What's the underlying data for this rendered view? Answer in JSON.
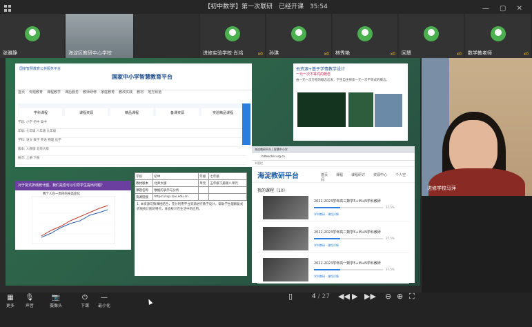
{
  "titlebar": {
    "title": "【初中数学】第一次联研",
    "status": "已经开课",
    "time": "35:54"
  },
  "participants": [
    {
      "name": "张雅静",
      "badge": "",
      "kind": "avatar"
    },
    {
      "name": "海淀区教研中心学校",
      "badge": "",
      "kind": "room"
    },
    {
      "name": "",
      "badge": "",
      "kind": "blank"
    },
    {
      "name": "进修实验学校·肖鸿",
      "badge": "x0",
      "kind": "avatar"
    },
    {
      "name": "孙琪",
      "badge": "x0",
      "kind": "avatar"
    },
    {
      "name": "林秀艳",
      "badge": "x0",
      "kind": "avatar"
    },
    {
      "name": "回慧",
      "badge": "x0",
      "kind": "avatar"
    },
    {
      "name": "数学教老师",
      "badge": "x0",
      "kind": "avatar"
    }
  ],
  "speaker": {
    "label": "进修学校马萍"
  },
  "platform": {
    "header_logo": "国家智慧教育公共服务平台",
    "title": "国家中小学智慧教育平台",
    "nav": [
      "首页",
      "专题教育",
      "课程教学",
      "课后服务",
      "教师研修",
      "家庭教育",
      "教改实践",
      "教材",
      "地方频道"
    ],
    "cards": [
      "学科课程",
      "课程资源",
      "精品课程",
      "备课资源",
      "实验精品课程"
    ],
    "filters": [
      "学段: 小学 初中 高中",
      "年级: 七年级 八年级 九年级",
      "学科: 语文 数学 英语 物理 化学",
      "版本: 人教版 北师大版",
      "册次: 上册 下册"
    ]
  },
  "doc": {
    "rows": [
      [
        "学段",
        "初中",
        "年级",
        "七年级"
      ],
      [
        "教材版本",
        "北师大版",
        "单元",
        "五年级下册第八单元"
      ],
      [
        "课题名称",
        "数据的表示与分析",
        "",
        ""
      ],
      [
        "资源链接",
        "https://ssp.zxx.edu.cn",
        "",
        ""
      ]
    ],
    "paragraph": "1. 本资源与微课相结合，充分利用平台资源进行教学设计，帮助学生理解复式折线统计图的特点，体会统计在生活中的应用。"
  },
  "graph": {
    "header": "对于复式折线统计图，我们是否可以引导学生提出问题？",
    "chart_title": "两个人在一周内的身高变化"
  },
  "design": {
    "title": "云资源+基于学情教学设计",
    "subtitle": "一元一次不等式的概念",
    "text": "由一元一次方程的概念出发，学生自主探索一元一次不等式的概念。"
  },
  "browser": {
    "tabs": "海淀教研平台 | 智慧中小学",
    "url": "hdteacher.org.cn",
    "bookmarks": "书签栏",
    "brand": "海淀教研平台",
    "menu": [
      "首页",
      "课程",
      "课程研讨",
      "资源中心",
      "个人空间"
    ],
    "my_courses": "我的课程（10）",
    "courses": [
      {
        "title": "2022-2023学年高三数学5+M+N学科教研",
        "pct": "37.5%",
        "pct_value": 0.375,
        "sub": "学科教研 · 课程详情"
      },
      {
        "title": "2022-2023学年高二数学5+M+N学科教研",
        "pct": "37.5%",
        "pct_value": 0.375,
        "sub": "学科教研 · 课程详情"
      },
      {
        "title": "2022-2023学年高一数学5+M+N学科教研",
        "pct": "37.5%",
        "pct_value": 0.375,
        "sub": "学科教研 · 课程详情"
      }
    ]
  },
  "toolbar": {
    "buttons": [
      "更多",
      "声音",
      "摄像头",
      "下课",
      "最小化"
    ],
    "page_current": "4",
    "page_total": "/ 27"
  }
}
